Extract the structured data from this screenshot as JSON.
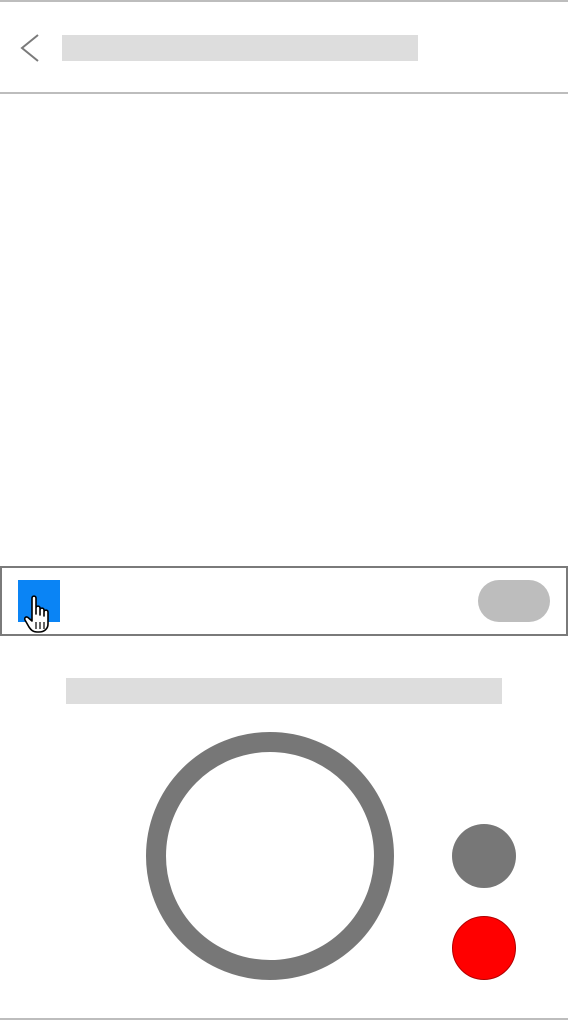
{
  "header": {
    "back_icon": "chevron-left-icon",
    "title": ""
  },
  "toolbar": {
    "select_icon": "hand-pointer-icon",
    "select_color": "#0a84f5",
    "toggle_color": "#bdbdbd"
  },
  "capture": {
    "caption": "",
    "shutter_color": "#777777",
    "secondary_color": "#777777",
    "record_color": "#ff0000"
  }
}
